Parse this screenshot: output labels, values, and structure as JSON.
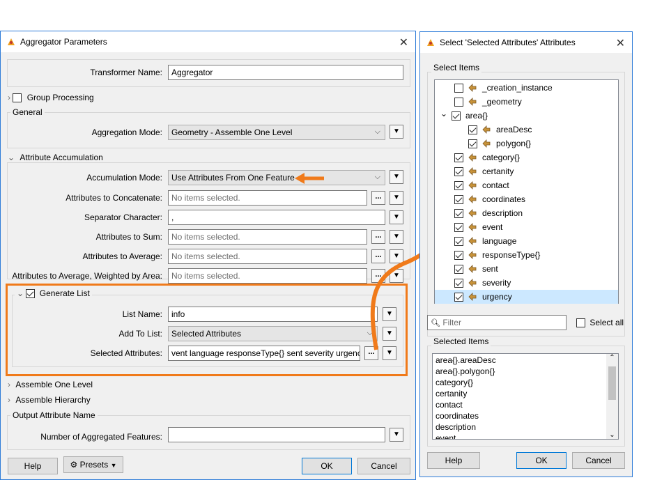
{
  "left_dialog": {
    "title": "Aggregator Parameters",
    "transformer_name_label": "Transformer Name:",
    "transformer_name_value": "Aggregator",
    "group_processing_label": "Group Processing",
    "general_label": "General",
    "aggregation_mode_label": "Aggregation Mode:",
    "aggregation_mode_value": "Geometry - Assemble One Level",
    "attribute_accumulation_label": "Attribute Accumulation",
    "accumulation_mode_label": "Accumulation Mode:",
    "accumulation_mode_value": "Use Attributes From One Feature",
    "attrs_concat_label": "Attributes to Concatenate:",
    "attrs_concat_value": "No items selected.",
    "separator_label": "Separator Character:",
    "separator_value": ",",
    "attrs_sum_label": "Attributes to Sum:",
    "attrs_sum_value": "No items selected.",
    "attrs_avg_label": "Attributes to Average:",
    "attrs_avg_value": "No items selected.",
    "attrs_avg_weighted_label": "Attributes to Average, Weighted by Area:",
    "attrs_avg_weighted_value": "No items selected.",
    "generate_list_label": "Generate List",
    "list_name_label": "List Name:",
    "list_name_value": "info",
    "add_to_list_label": "Add To List:",
    "add_to_list_value": "Selected Attributes",
    "selected_attrs_label": "Selected Attributes:",
    "selected_attrs_value": "vent language responseType{} sent severity urgency",
    "assemble_one_level_label": "Assemble One Level",
    "assemble_hierarchy_label": "Assemble Hierarchy",
    "output_attr_name_label": "Output Attribute Name",
    "num_aggregated_label": "Number of Aggregated Features:",
    "num_aggregated_value": "",
    "help_label": "Help",
    "presets_label": "Presets",
    "ok_label": "OK",
    "cancel_label": "Cancel",
    "ellipsis": "...",
    "menu_arrow": "▼"
  },
  "right_dialog": {
    "title": "Select 'Selected Attributes' Attributes",
    "select_items_label": "Select Items",
    "tree_items": [
      {
        "label": "_creation_instance",
        "checked": false
      },
      {
        "label": "_geometry",
        "checked": false
      },
      {
        "label": "area{}",
        "checked": true
      },
      {
        "label": "areaDesc",
        "checked": true
      },
      {
        "label": "polygon{}",
        "checked": true
      },
      {
        "label": "category{}",
        "checked": true
      },
      {
        "label": "certanity",
        "checked": true
      },
      {
        "label": "contact",
        "checked": true
      },
      {
        "label": "coordinates",
        "checked": true
      },
      {
        "label": "description",
        "checked": true
      },
      {
        "label": "event",
        "checked": true
      },
      {
        "label": "language",
        "checked": true
      },
      {
        "label": "responseType{}",
        "checked": true
      },
      {
        "label": "sent",
        "checked": true
      },
      {
        "label": "severity",
        "checked": true
      },
      {
        "label": "urgency",
        "checked": true
      }
    ],
    "filter_placeholder": "Filter",
    "select_all_label": "Select all",
    "selected_items_label": "Selected Items",
    "selected_items": [
      "area{}.areaDesc",
      "area{}.polygon{}",
      "category{}",
      "certanity",
      "contact",
      "coordinates",
      "description",
      "event"
    ],
    "help_label": "Help",
    "ok_label": "OK",
    "cancel_label": "Cancel"
  },
  "colors": {
    "highlight_orange": "#f07a1a",
    "dialog_border": "#2b7ad8",
    "selection_blue": "#cce8ff"
  }
}
